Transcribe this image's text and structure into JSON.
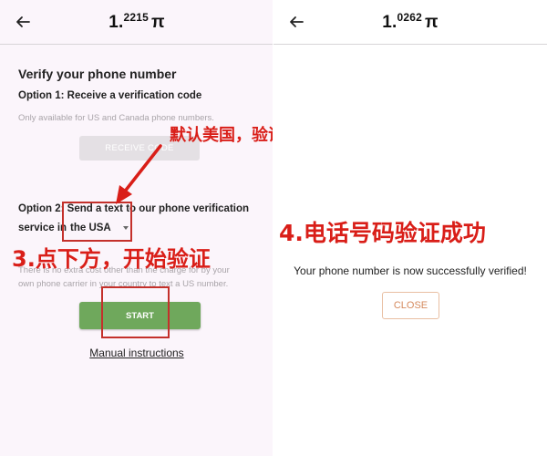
{
  "left": {
    "balance": {
      "whole": "1.",
      "decimals": "2215",
      "symbol": "π"
    },
    "title": "Verify your phone number",
    "option1": {
      "label": "Option 1: Receive a verification code",
      "note": "Only available for US and Canada phone numbers.",
      "button_label": "RECEIVE CODE"
    },
    "option2": {
      "label_part1": "Option 2: Send a text to our phone verification",
      "label_prefix": "service in",
      "selected_country": "the USA",
      "note_line1": "There is no extra cost other than the charge for by your",
      "note_line2": "own phone carrier in your country to text a US number."
    },
    "start_label": "START",
    "manual_link": "Manual instructions"
  },
  "annotations": {
    "default_country": "默认美国，验证不了可切换英国",
    "step3": "3.点下方，开始验证",
    "step4": "4.电话号码验证成功"
  },
  "right": {
    "balance": {
      "whole": "1.",
      "decimals": "0262",
      "symbol": "π"
    },
    "success_message": "Your phone number is now successfully verified!",
    "close_label": "CLOSE"
  },
  "icons": {
    "back": "back-arrow-icon",
    "select_caret": "chevron-down-icon"
  },
  "colors": {
    "start_button": "#6fa85c",
    "annotation_red": "#d91e18",
    "close_text": "#d58a5e"
  }
}
